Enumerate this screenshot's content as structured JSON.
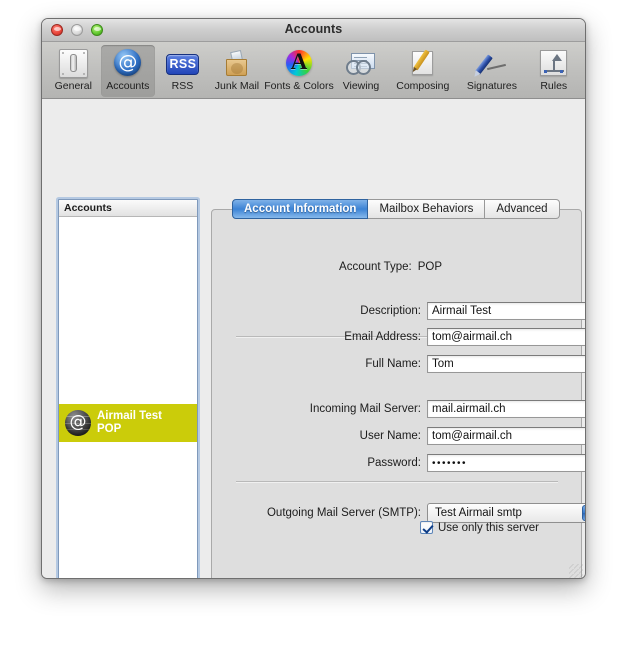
{
  "window": {
    "title": "Accounts",
    "traffic_lights": [
      "close",
      "minimize",
      "zoom"
    ]
  },
  "toolbar": {
    "items": [
      {
        "label": "General",
        "icon": "general-icon",
        "selected": false
      },
      {
        "label": "Accounts",
        "icon": "at-sign-icon",
        "selected": true
      },
      {
        "label": "RSS",
        "icon": "rss-icon",
        "selected": false
      },
      {
        "label": "Junk Mail",
        "icon": "junk-bag-icon",
        "selected": false
      },
      {
        "label": "Fonts & Colors",
        "icon": "fonts-color-icon",
        "selected": false
      },
      {
        "label": "Viewing",
        "icon": "viewing-icon",
        "selected": false
      },
      {
        "label": "Composing",
        "icon": "composing-icon",
        "selected": false
      },
      {
        "label": "Signatures",
        "icon": "signature-icon",
        "selected": false
      },
      {
        "label": "Rules",
        "icon": "rules-icon",
        "selected": false
      }
    ]
  },
  "sidebar": {
    "header": "Accounts",
    "accounts": [
      {
        "name": "Airmail Test",
        "type": "POP",
        "selected": true,
        "highlight_color": "#cbcc0a"
      }
    ],
    "add_button": "+",
    "remove_button": "−"
  },
  "tabs": [
    {
      "label": "Account Information",
      "active": true
    },
    {
      "label": "Mailbox Behaviors",
      "active": false
    },
    {
      "label": "Advanced",
      "active": false
    }
  ],
  "form": {
    "account_type_label": "Account Type:",
    "account_type_value": "POP",
    "description_label": "Description:",
    "description_value": "Airmail Test",
    "email_label": "Email Address:",
    "email_value": "tom@airmail.ch",
    "full_name_label": "Full Name:",
    "full_name_value": "Tom",
    "incoming_label": "Incoming Mail Server:",
    "incoming_value": "mail.airmail.ch",
    "username_label": "User Name:",
    "username_value": "tom@airmail.ch",
    "password_label": "Password:",
    "password_value": "•••••••",
    "smtp_label": "Outgoing Mail Server (SMTP):",
    "smtp_value": "Test Airmail smtp",
    "use_only_label": "Use only this server",
    "use_only_checked": true
  },
  "help_button": "?"
}
